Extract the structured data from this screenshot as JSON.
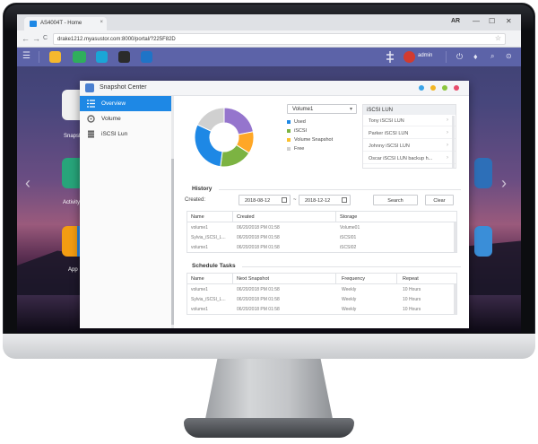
{
  "browser": {
    "tab_title": "AS4004T - Home",
    "tab_close": "×",
    "user_tag": "AR",
    "window_controls": [
      "—",
      "☐",
      "✕"
    ],
    "url": "drake1212.myasustor.com:8000/portal/?225F82D",
    "back": "←",
    "forward": "→",
    "reload": "C",
    "star": "☆"
  },
  "taskbar": {
    "menu_glyph": "☰",
    "username": "admin",
    "apps": [
      {
        "name": "explorer",
        "color": "#f5b82e"
      },
      {
        "name": "storage",
        "color": "#2fae5c"
      },
      {
        "name": "app-central",
        "color": "#1aa6d6"
      },
      {
        "name": "settings",
        "color": "#2b2b2b"
      },
      {
        "name": "cloud",
        "color": "#1f74c7"
      }
    ],
    "right_glyphs": [
      "⏻",
      "♦",
      "⌕"
    ]
  },
  "desktop": {
    "labels": [
      "Snapsh",
      "Activity",
      "App"
    ],
    "prev_arrow": "‹",
    "next_arrow": "›"
  },
  "window": {
    "title": "Snapshot Center",
    "dots": [
      "#3aa4e8",
      "#f3b624",
      "#8cc63e",
      "#e74c6b"
    ],
    "sidebar": [
      {
        "label": "Overview",
        "active": true,
        "icon": "overview-icon"
      },
      {
        "label": "Volume",
        "active": false,
        "icon": "volume-icon"
      },
      {
        "label": "iSCSI Lun",
        "active": false,
        "icon": "iscsi-icon"
      }
    ],
    "overview": {
      "volume_select": "Volume1",
      "legend": [
        {
          "label": "Used",
          "color": "#1e88e5"
        },
        {
          "label": "iSCSI",
          "color": "#7cb342"
        },
        {
          "label": "Volume Snapshot",
          "color": "#fbc02d"
        },
        {
          "label": "Free",
          "color": "#d0d0d0"
        }
      ],
      "donut": [
        {
          "name": "purple",
          "value": 22,
          "color": "#9575cd"
        },
        {
          "name": "orange",
          "value": 12,
          "color": "#ffa726"
        },
        {
          "name": "green",
          "value": 18,
          "color": "#7cb342"
        },
        {
          "name": "blue",
          "value": 30,
          "color": "#1e88e5"
        },
        {
          "name": "grey",
          "value": 18,
          "color": "#d0d0d0"
        }
      ],
      "lun_panel_title": "iSCSI LUN",
      "luns": [
        "Tony iSCSI LUN",
        "Parker iSCSI LUN",
        "Johnny iSCSI LUN",
        "Oscar iSCSI LUN backup h..."
      ]
    },
    "history": {
      "title": "History",
      "created_label": "Created:",
      "from_date": "2018-08-12",
      "to_sep": "~",
      "to_date": "2018-12-12",
      "search_label": "Search",
      "clear_label": "Clear",
      "columns": [
        "Name",
        "Created",
        "Storage"
      ],
      "rows": [
        [
          "volume1",
          "06/20/2018 PM 01:58",
          "Volume01"
        ],
        [
          "Sylvia_iSCSI_L...",
          "06/20/2018 PM 01:58",
          "iSCSI01"
        ],
        [
          "volume1",
          "06/20/2018 PM 01:58",
          "iSCSI02"
        ]
      ]
    },
    "schedule": {
      "title": "Schedule Tasks",
      "columns": [
        "Name",
        "Next Snapshot",
        "Frequency",
        "Repeat"
      ],
      "rows": [
        [
          "volume1",
          "06/20/2018 PM 01:58",
          "Weekly",
          "10 Hours"
        ],
        [
          "Sylvia_iSCSI_L...",
          "06/20/2018 PM 01:58",
          "Weekly",
          "10 Hours"
        ],
        [
          "volume1",
          "06/20/2018 PM 01:58",
          "Weekly",
          "10 Hours"
        ]
      ]
    }
  }
}
